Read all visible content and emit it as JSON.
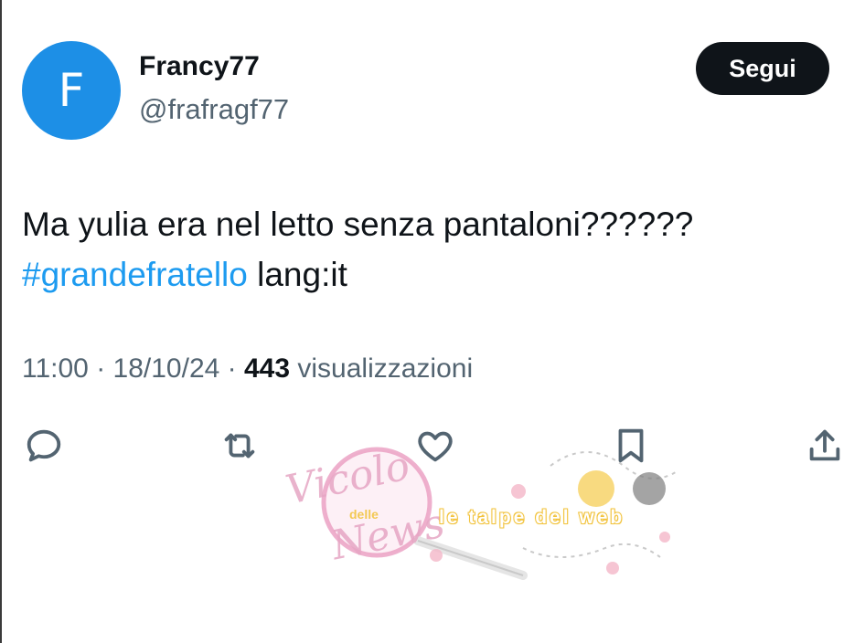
{
  "author": {
    "avatar_letter": "F",
    "avatar_color": "#1d8fe6",
    "display_name": "Francy77",
    "handle": "@frafragf77"
  },
  "follow_button": {
    "label": "Segui"
  },
  "tweet": {
    "text_line1": "Ma yulia era nel letto senza pantaloni??????",
    "hashtag": "#grandefratello",
    "suffix": " lang:it"
  },
  "meta": {
    "time": "11:00",
    "separator": " · ",
    "date": "18/10/24",
    "views_count": "443",
    "views_label": " visualizzazioni"
  },
  "actions": [
    {
      "icon": "reply-icon"
    },
    {
      "icon": "retweet-icon"
    },
    {
      "icon": "like-icon"
    },
    {
      "icon": "bookmark-icon"
    },
    {
      "icon": "share-icon"
    }
  ],
  "watermark": {
    "script_top": "Vicolo",
    "small": "delle",
    "script_bottom": "News",
    "band": "le talpe del web"
  },
  "colors": {
    "text": "#0f1419",
    "secondary": "#536471",
    "link": "#1d9bf0",
    "button_bg": "#0f1419",
    "watermark_pink": "#e6a6c4",
    "watermark_yellow": "#f2c33d"
  }
}
